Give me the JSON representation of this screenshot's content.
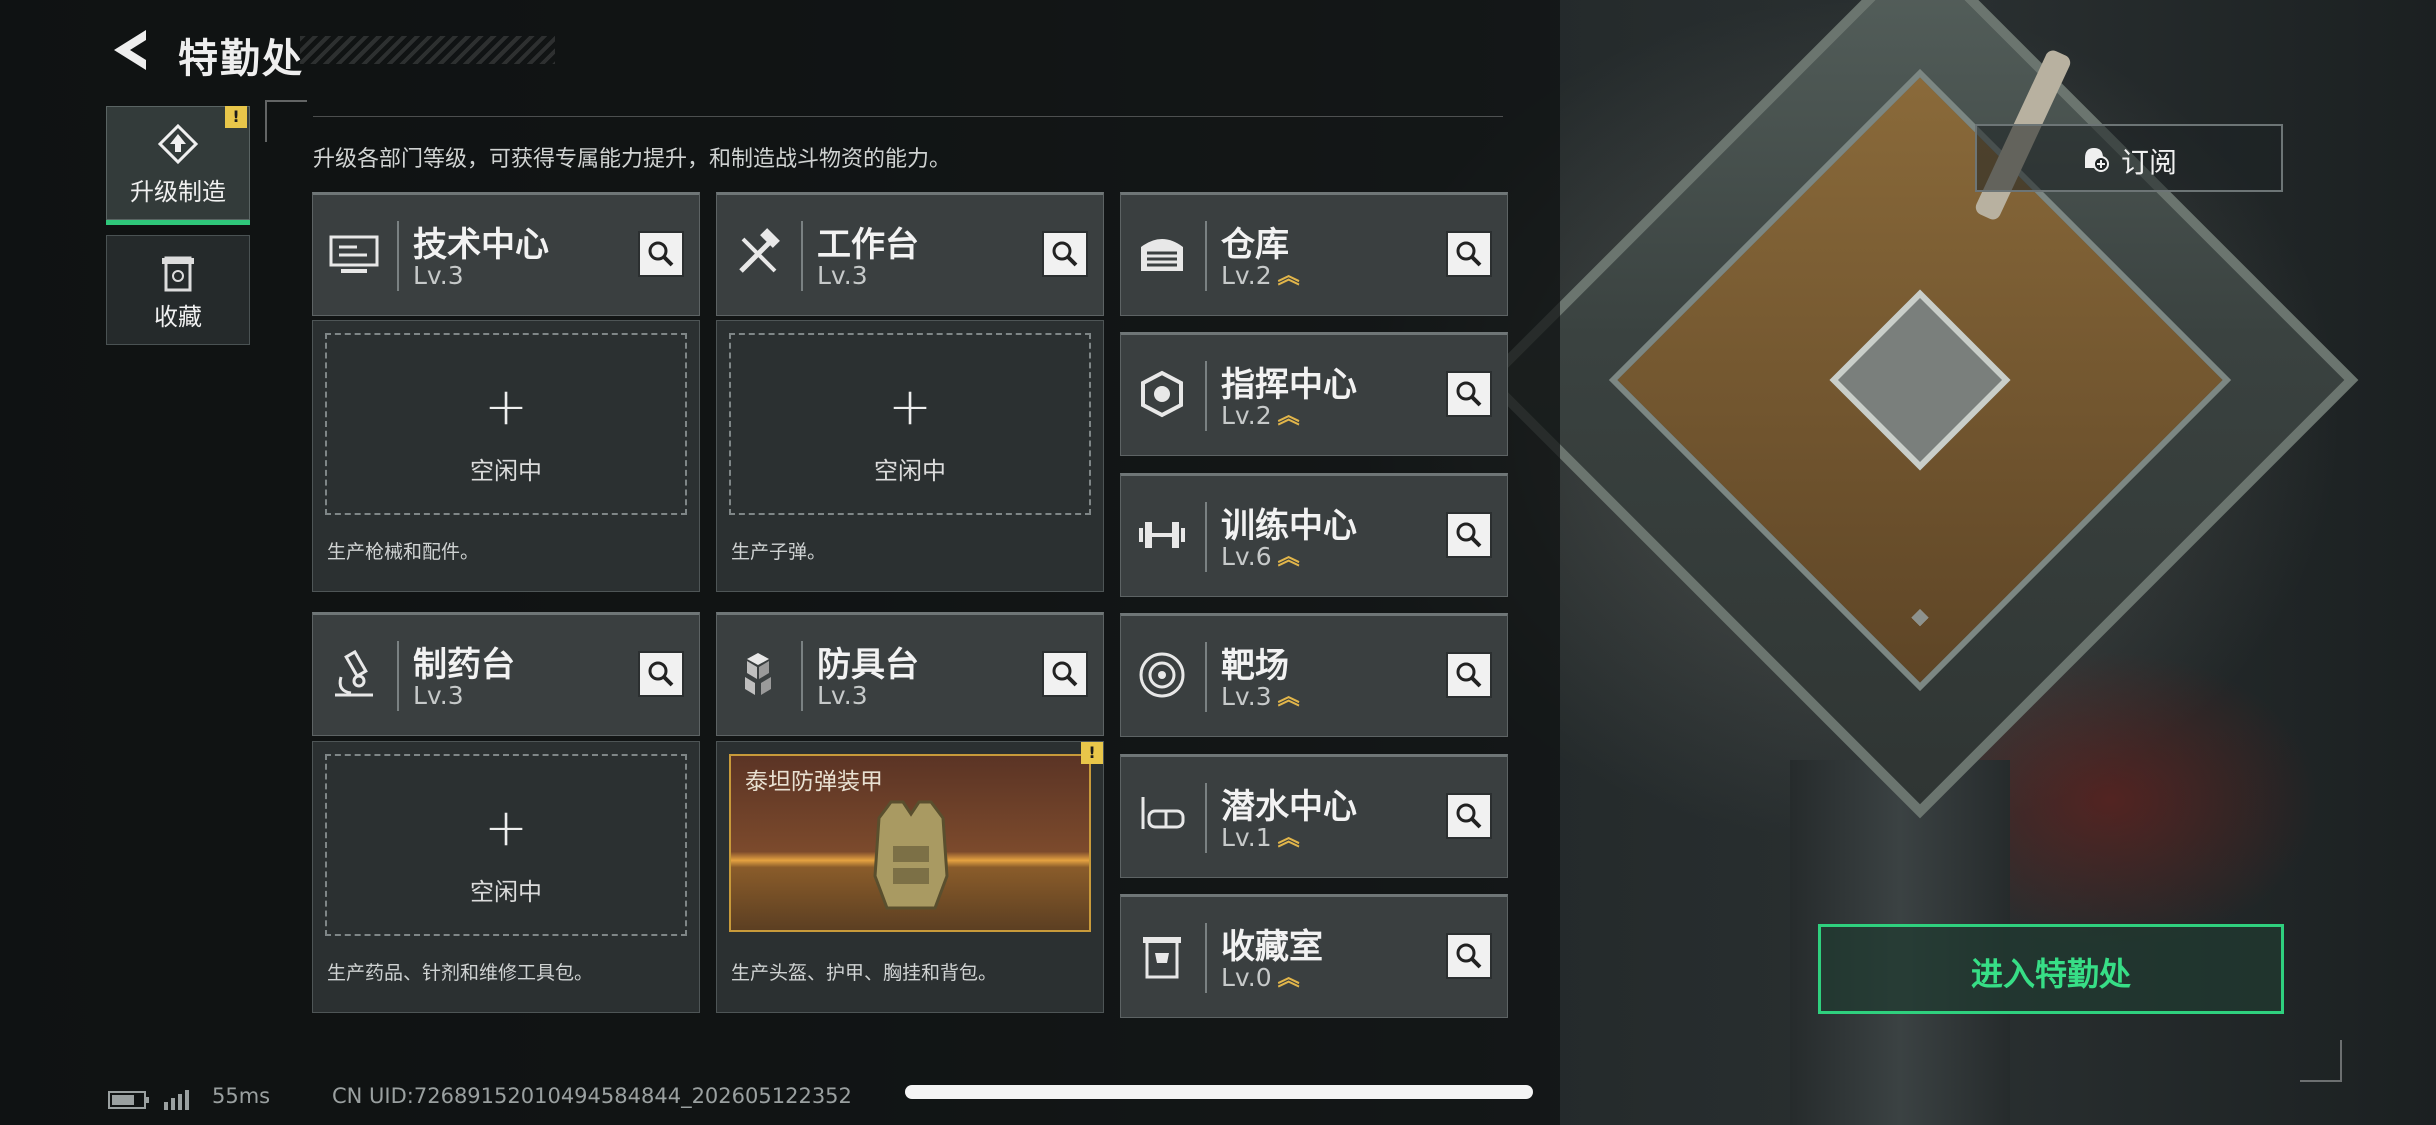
{
  "header": {
    "title": "特勤处",
    "hint": "升级各部门等级，可获得专属能力提升，和制造战斗物资的能力。"
  },
  "sidebar": {
    "items": [
      {
        "label": "升级制造",
        "icon": "upgrade-icon",
        "active": true,
        "warning": "!"
      },
      {
        "label": "收藏",
        "icon": "collection-icon",
        "active": false
      }
    ]
  },
  "departments": {
    "tech": {
      "name": "技术中心",
      "level": "Lv.3",
      "icon": "monitor-icon"
    },
    "workbench": {
      "name": "工作台",
      "level": "Lv.3",
      "icon": "tools-icon"
    },
    "pharmacy": {
      "name": "制药台",
      "level": "Lv.3",
      "icon": "microscope-icon"
    },
    "armor": {
      "name": "防具台",
      "level": "Lv.3",
      "icon": "cubes-icon"
    },
    "warehouse": {
      "name": "仓库",
      "level": "Lv.2",
      "icon": "garage-icon",
      "upgradable": true
    },
    "command": {
      "name": "指挥中心",
      "level": "Lv.2",
      "icon": "chip-icon",
      "upgradable": true
    },
    "training": {
      "name": "训练中心",
      "level": "Lv.6",
      "icon": "dumbbell-icon",
      "upgradable": true
    },
    "range": {
      "name": "靶场",
      "level": "Lv.3",
      "icon": "target-icon",
      "upgradable": true
    },
    "diving": {
      "name": "潜水中心",
      "level": "Lv.1",
      "icon": "diving-mask-icon",
      "upgradable": true
    },
    "vault": {
      "name": "收藏室",
      "level": "Lv.0",
      "icon": "trophy-icon",
      "upgradable": true
    }
  },
  "production": {
    "tech": {
      "plus": "+",
      "status": "空闲中",
      "desc": "生产枪械和配件。"
    },
    "workbench": {
      "plus": "+",
      "status": "空闲中",
      "desc": "生产子弹。"
    },
    "pharmacy": {
      "plus": "+",
      "status": "空闲中",
      "desc": "生产药品、针剂和维修工具包。"
    },
    "armor": {
      "item": "泰坦防弹装甲",
      "desc": "生产头盔、护甲、胸挂和背包。",
      "warning": "!"
    }
  },
  "actions": {
    "subscribe": "订阅",
    "enter": "进入特勤处"
  },
  "footer": {
    "ping": "55ms",
    "uid": "CN UID:72689152010494584844_202605122352"
  },
  "colors": {
    "accent_green": "#2fd07e",
    "upgrade_gold": "#e1b54a",
    "warning_yellow": "#e8c64a"
  }
}
